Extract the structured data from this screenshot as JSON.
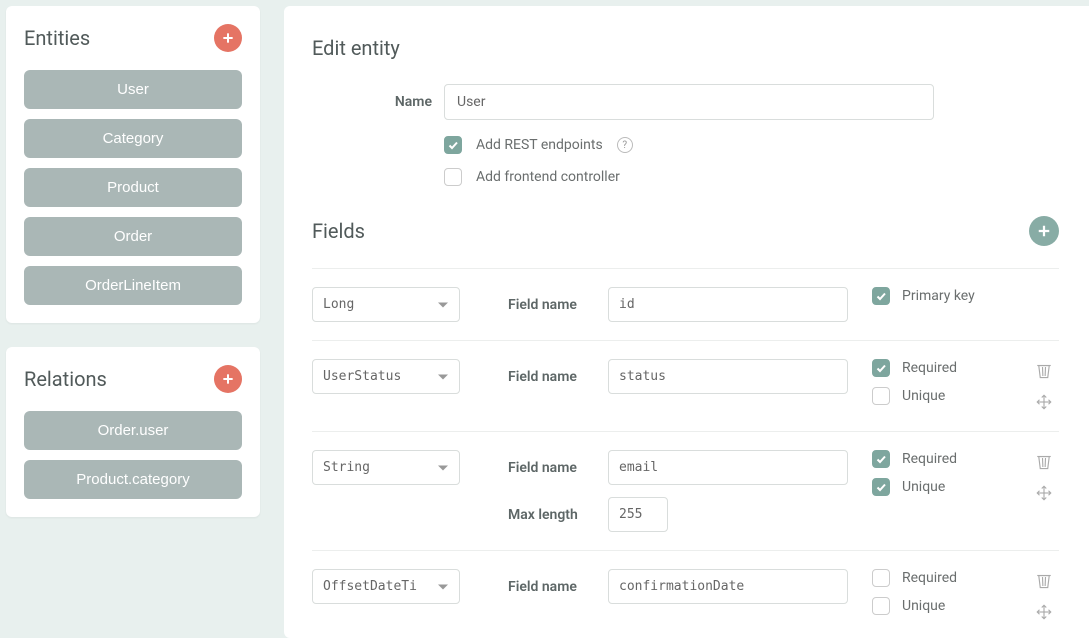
{
  "sidebar": {
    "entities": {
      "title": "Entities",
      "items": [
        "User",
        "Category",
        "Product",
        "Order",
        "OrderLineItem"
      ]
    },
    "relations": {
      "title": "Relations",
      "items": [
        "Order.user",
        "Product.category"
      ]
    }
  },
  "main": {
    "title": "Edit entity",
    "nameLabel": "Name",
    "nameValue": "User",
    "addRestLabel": "Add REST endpoints",
    "addRestChecked": true,
    "addFrontendLabel": "Add frontend controller",
    "addFrontendChecked": false,
    "fieldsTitle": "Fields",
    "labels": {
      "fieldName": "Field name",
      "maxLength": "Max length",
      "primaryKey": "Primary key",
      "required": "Required",
      "unique": "Unique"
    },
    "fields": [
      {
        "type": "Long",
        "name": "id",
        "primaryKey": true
      },
      {
        "type": "UserStatus",
        "name": "status",
        "required": true,
        "unique": false,
        "actions": true
      },
      {
        "type": "String",
        "name": "email",
        "required": true,
        "unique": true,
        "maxLength": "255",
        "actions": true
      },
      {
        "type": "OffsetDateTime",
        "typeDisplay": "OffsetDateTi",
        "name": "confirmationDate",
        "required": false,
        "unique": false,
        "actions": true
      }
    ]
  }
}
